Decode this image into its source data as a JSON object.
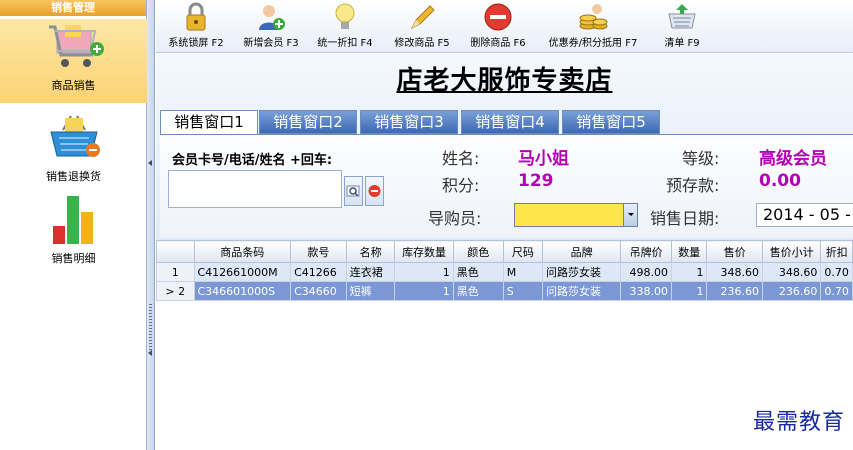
{
  "sidebar": {
    "header": "销售管理",
    "items": [
      {
        "label": "商品销售",
        "icon": "shopping-cart-icon",
        "active": true
      },
      {
        "label": "销售退换货",
        "icon": "basket-icon",
        "active": false
      },
      {
        "label": "销售明细",
        "icon": "bar-chart-icon",
        "active": false
      }
    ]
  },
  "toolbar": {
    "buttons": [
      {
        "label": "系统锁屏 F2",
        "icon": "lock-icon"
      },
      {
        "label": "新增会员 F3",
        "icon": "add-user-icon"
      },
      {
        "label": "统一折扣 F4",
        "icon": "lightbulb-icon"
      },
      {
        "label": "修改商品 F5",
        "icon": "pencil-icon"
      },
      {
        "label": "删除商品 F6",
        "icon": "delete-icon"
      },
      {
        "label": "优惠券/积分抵用 F7",
        "icon": "coins-icon"
      },
      {
        "label": "清单 F9",
        "icon": "cart-list-icon"
      }
    ]
  },
  "store": {
    "title": "店老大服饰专卖店"
  },
  "tabs": [
    "销售窗口1",
    "销售窗口2",
    "销售窗口3",
    "销售窗口4",
    "销售窗口5"
  ],
  "member": {
    "prompt": "会员卡号/电话/姓名 +回车:",
    "input_value": "",
    "name_label": "姓名:",
    "name_value": "马小姐",
    "level_label": "等级:",
    "level_value": "高级会员",
    "points_label": "积分:",
    "points_value": "129",
    "deposit_label": "预存款:",
    "deposit_value": "0.00",
    "guide_label": "导购员:",
    "guide_value": "",
    "date_label": "销售日期:",
    "date_value": "2014 - 05 -"
  },
  "grid": {
    "columns": [
      "",
      "商品条码",
      "款号",
      "名称",
      "库存数量",
      "颜色",
      "尺码",
      "品牌",
      "吊牌价",
      "数量",
      "售价",
      "售价小计",
      "折扣"
    ],
    "rows": [
      {
        "indicator": "1",
        "cells": [
          "C412661000M",
          "C41266",
          "连衣裙",
          "1",
          "黑色",
          "M",
          "问路莎女装",
          "498.00",
          "1",
          "348.60",
          "348.60",
          "0.70"
        ],
        "selected": false
      },
      {
        "indicator": "> 2",
        "cells": [
          "C346601000S",
          "C34660",
          "短裤",
          "1",
          "黑色",
          "S",
          "问路莎女装",
          "338.00",
          "1",
          "236.60",
          "236.60",
          "0.70"
        ],
        "selected": true
      }
    ]
  },
  "watermark": "最需教育",
  "colors": {
    "accent_purple": "#b400b4",
    "tab_blue": "#3d68b1",
    "selected_row": "#7b97d6",
    "guide_yellow": "#ffe44a"
  }
}
